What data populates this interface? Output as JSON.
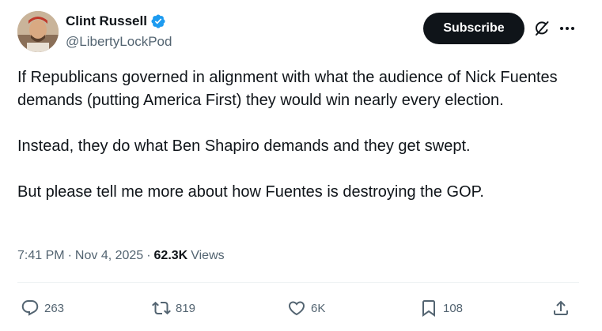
{
  "author": {
    "display_name": "Clint Russell",
    "handle": "@LibertyLockPod"
  },
  "header": {
    "subscribe_label": "Subscribe"
  },
  "tweet": {
    "paragraphs": [
      "If Republicans governed in alignment with what the audience of Nick Fuentes demands (putting America First) they would win nearly every election.",
      "Instead, they do what Ben Shapiro demands and they get swept.",
      "But please tell me more about how Fuentes is destroying the GOP."
    ],
    "time": "7:41 PM",
    "separator": "·",
    "date": "Nov 4, 2025",
    "views_count": "62.3K",
    "views_label": "Views"
  },
  "actions": {
    "replies": "263",
    "reposts": "819",
    "likes": "6K",
    "bookmarks": "108"
  },
  "colors": {
    "primary_text": "#0f1419",
    "secondary_text": "#536471",
    "verified_blue": "#1d9bf0",
    "button_bg": "#0f1419"
  },
  "icons": [
    "verified-badge-icon",
    "grok-icon",
    "more-icon",
    "reply-icon",
    "repost-icon",
    "like-icon",
    "bookmark-icon",
    "share-icon"
  ]
}
